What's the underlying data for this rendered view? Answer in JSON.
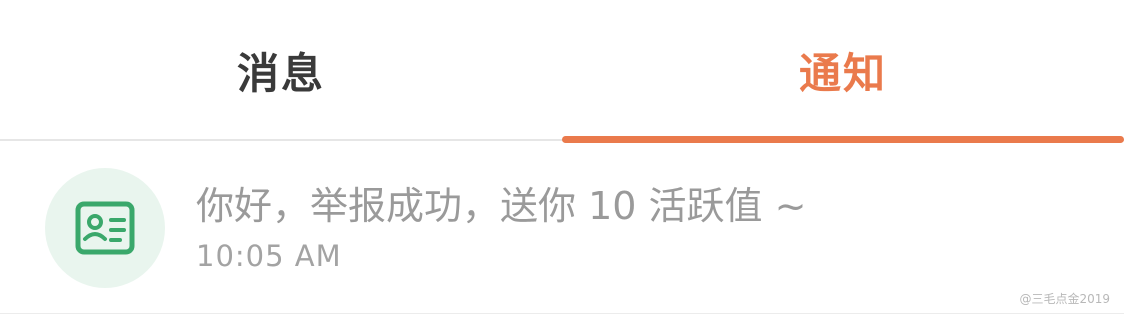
{
  "tabs": {
    "messages_label": "消息",
    "notifications_label": "通知",
    "active": "notifications"
  },
  "notification": {
    "icon": "id-card-icon",
    "text": "你好，举报成功，送你 10 活跃值 ~",
    "time": "10:05 AM"
  },
  "watermark": "@三毛点金2019",
  "colors": {
    "accent": "#ea7a4c",
    "icon_green": "#3aa86b",
    "icon_bg": "#e9f5ee"
  }
}
